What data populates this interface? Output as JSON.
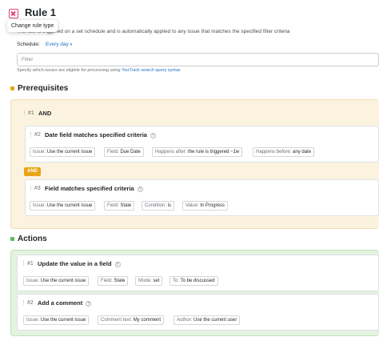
{
  "header": {
    "title": "Rule 1",
    "tooltip": "Change rule type",
    "description": "The rule is triggered on a set schedule and is automatically applied to any issue that matches the specified filter criteria",
    "schedule_label": "Schedule:",
    "schedule_value": "Every day",
    "filter_placeholder": "Filter",
    "hint_text": "Specify which issues are eligible for processing using",
    "hint_link": "YouTrack search query syntax"
  },
  "prerequisites": {
    "title": "Prerequisites",
    "group_number": "#1",
    "group_label": "AND",
    "and_badge": "AND",
    "items": [
      {
        "number": "#2",
        "title": "Date field matches specified criteria",
        "chips": [
          {
            "key": "Issue:",
            "value": "Use the current issue"
          },
          {
            "key": "Field:",
            "value": "Due Date"
          },
          {
            "key": "Happens after:",
            "value": "the rule is triggered ~1w"
          },
          {
            "key": "Happens before:",
            "value": "any date"
          }
        ]
      },
      {
        "number": "#3",
        "title": "Field matches specified criteria",
        "chips": [
          {
            "key": "Issue:",
            "value": "Use the current issue"
          },
          {
            "key": "Field:",
            "value": "State"
          },
          {
            "key": "Condition:",
            "value": "is"
          },
          {
            "key": "Value:",
            "value": "In Progress"
          }
        ]
      }
    ]
  },
  "actions": {
    "title": "Actions",
    "items": [
      {
        "number": "#1",
        "title": "Update the value in a field",
        "chips": [
          {
            "key": "Issue:",
            "value": "Use the current issue"
          },
          {
            "key": "Field:",
            "value": "State"
          },
          {
            "key": "Mode:",
            "value": "set"
          },
          {
            "key": "To:",
            "value": "To be discussed"
          }
        ]
      },
      {
        "number": "#2",
        "title": "Add a comment",
        "chips": [
          {
            "key": "Issue:",
            "value": "Use the current issue"
          },
          {
            "key": "Comment text:",
            "value": "My comment"
          },
          {
            "key": "Author:",
            "value": "Use the current user"
          }
        ]
      }
    ]
  },
  "colors": {
    "prereq_bg": "#fbf3df",
    "prereq_border": "#f0dfb0",
    "prereq_bullet": "#e8a317",
    "actions_bg": "#e3f3df",
    "actions_border": "#bfe3b6",
    "actions_bullet": "#5dbb63",
    "link": "#1f6fc9",
    "rule_icon": "#e0457b"
  },
  "icons": {
    "rule_type": "rule-type-icon",
    "drag": "drag-handle-icon",
    "help": "help-icon",
    "chevron": "chevron-down-icon"
  }
}
